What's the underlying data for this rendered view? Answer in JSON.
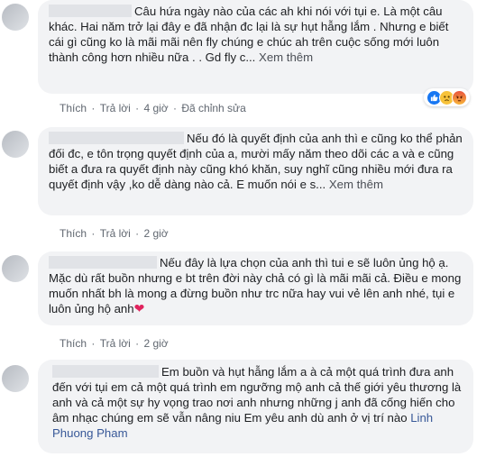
{
  "comments": [
    {
      "text": "Câu hứa ngày nào của các ah khi nói với tụi e. Là một câu khác. Hai năm trở lại đây e đã nhận đc lại là sự hụt hẫng lắm . Nhưng e biết cái gì cũng ko là mãi mãi nên fly chúng e chúc ah trên cuộc sống mới luôn thành công hơn nhiều nữa . . Gd fly c...",
      "see_more": "Xem thêm",
      "like": "Thích",
      "reply": "Trả lời",
      "time": "4 giờ",
      "edited": "Đã chỉnh sửa",
      "reactions": [
        "like-reaction",
        "sad-reaction",
        "angry-reaction"
      ]
    },
    {
      "text": "Nếu đó là quyết định của anh thì e cũng ko thể phản đối đc, e tôn trọng quyết định của a, mười mấy năm theo dõi các a và e cũng biết a đưa ra quyết định này cũng khó khăn, suy nghĩ cũng nhiều mới đưa ra quyết định vậy ,ko dễ dàng nào cả. E muốn nói e s...",
      "see_more": "Xem thêm",
      "like": "Thích",
      "reply": "Trả lời",
      "time": "2 giờ"
    },
    {
      "text": "Nếu đây là lựa chọn của anh thì tui e sẽ luôn ủng hộ ạ. Mặc dù rất buồn nhưng e bt trên đời này chả có gì là mãi mãi cả. Điều e mong muốn nhất bh là mong a đừng buồn như trc nữa hay vui vẻ lên anh nhé, tụi e luôn ủng hộ anh",
      "like": "Thích",
      "reply": "Trả lời",
      "time": "2 giờ"
    },
    {
      "text": "Em buồn và hụt hẫng lắm a à cả một quá trình đưa anh đến với tụi em cả một quá trình em ngưỡng mộ anh cả thế giới yêu thương là anh và cả một sự hy vọng trao nơi anh nhưng những j anh đã cống hiến cho âm nhạc chúng em sẽ vẫn nâng niu Em yêu anh dù anh ở vị trí nào",
      "mention": "Linh Phuong Pham"
    }
  ],
  "separator": " · "
}
